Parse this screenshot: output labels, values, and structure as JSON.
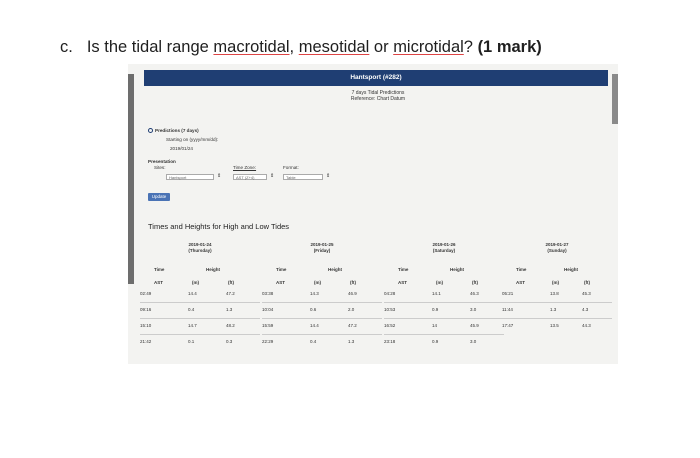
{
  "question": {
    "letter": "c.",
    "prefix": "Is the tidal range ",
    "term1": "macrotidal",
    "sep1": ", ",
    "term2": "mesotidal",
    "mid": " or ",
    "term3": "microtidal",
    "suffix": "? ",
    "marks": "(1 mark)"
  },
  "page": {
    "banner": "Hantsport (#282)",
    "subtitle1": "7 days Tidal Predictions",
    "subtitle2": "Reference: Chart Datum",
    "predictions_label": "Predictions (7 days)",
    "starting_on_label": "Starting on (yyyy/mm/dd):",
    "starting_on_value": "2019/01/24",
    "presentation_label": "Presentation",
    "sites_label": "Sites:",
    "site_value": "Hantsport",
    "timezone_label": "Time Zone:",
    "timezone_value": "AST (Z+4)",
    "format_label": "Format:",
    "format_value": "Table",
    "update_button": "Update",
    "section_title": "Times and Heights for High and Low Tides"
  },
  "table_headers": {
    "time": "Time",
    "height": "Height",
    "ast": "AST",
    "m": "(m)",
    "ft": "(ft)"
  },
  "days": [
    {
      "date": "2019-01-24",
      "weekday": "(Thursday)",
      "rows": [
        {
          "time": "02:49",
          "m": "14.4",
          "ft": "47.2"
        },
        {
          "time": "09:16",
          "m": "0.4",
          "ft": "1.3"
        },
        {
          "time": "15:10",
          "m": "14.7",
          "ft": "48.2"
        },
        {
          "time": "21:42",
          "m": "0.1",
          "ft": "0.3"
        }
      ]
    },
    {
      "date": "2019-01-25",
      "weekday": "(Friday)",
      "rows": [
        {
          "time": "03:38",
          "m": "14.3",
          "ft": "46.9"
        },
        {
          "time": "10:04",
          "m": "0.6",
          "ft": "2.0"
        },
        {
          "time": "15:59",
          "m": "14.4",
          "ft": "47.2"
        },
        {
          "time": "22:29",
          "m": "0.4",
          "ft": "1.3"
        }
      ]
    },
    {
      "date": "2019-01-26",
      "weekday": "(Saturday)",
      "rows": [
        {
          "time": "04:28",
          "m": "14.1",
          "ft": "46.3"
        },
        {
          "time": "10:53",
          "m": "0.9",
          "ft": "3.0"
        },
        {
          "time": "16:52",
          "m": "14",
          "ft": "45.9"
        },
        {
          "time": "23:18",
          "m": "0.9",
          "ft": "3.0"
        }
      ]
    },
    {
      "date": "2019-01-27",
      "weekday": "(Sunday)",
      "rows": [
        {
          "time": "05:21",
          "m": "13.8",
          "ft": "45.3"
        },
        {
          "time": "11:44",
          "m": "1.3",
          "ft": "4.3"
        },
        {
          "time": "17:47",
          "m": "13.5",
          "ft": "44.3"
        }
      ]
    }
  ]
}
